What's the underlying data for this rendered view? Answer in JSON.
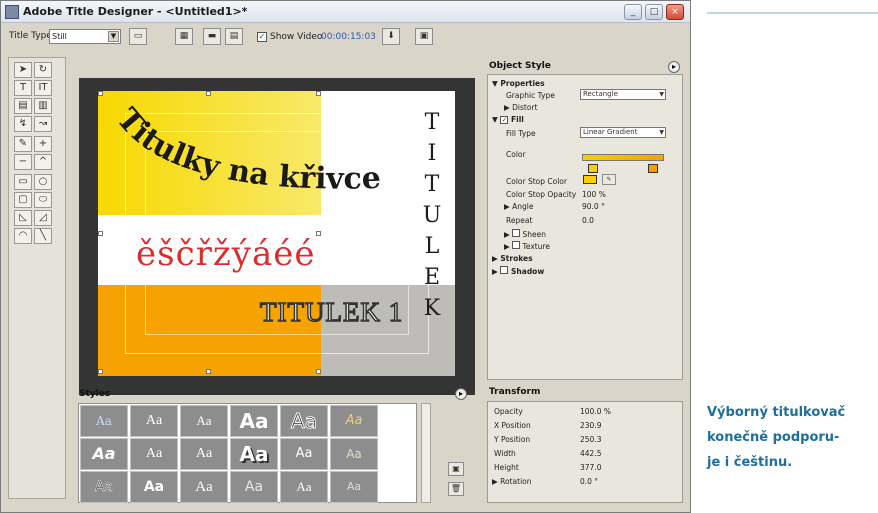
{
  "window": {
    "title": "Adobe Title Designer - <Untitled1>*",
    "min_label": "_",
    "max_label": "□",
    "close_label": "×"
  },
  "toolbar": {
    "title_type_label": "Title Type:",
    "title_type_value": "Still",
    "show_video_label": "Show Video",
    "timecode": "00:00:15:03",
    "show_video_checked": true
  },
  "canvas": {
    "curved_text": "Titulky na křivce",
    "red_text": "ěščřžýáéé",
    "outline_text": "TITULEK 1",
    "vertical_letters": [
      "T",
      "I",
      "T",
      "U",
      "L",
      "E",
      "K"
    ]
  },
  "object_style": {
    "header": "Object Style",
    "properties_label": "Properties",
    "graphic_type_label": "Graphic Type",
    "graphic_type_value": "Rectangle",
    "distort_label": "Distort",
    "fill_label": "Fill",
    "fill_type_label": "Fill Type",
    "fill_type_value": "Linear Gradient",
    "color_label": "Color",
    "color_stop_color_label": "Color Stop Color",
    "color_stop_opacity_label": "Color Stop Opacity",
    "color_stop_opacity_value": "100 %",
    "angle_label": "Angle",
    "angle_value": "90.0 °",
    "repeat_label": "Repeat",
    "repeat_value": "0.0",
    "sheen_label": "Sheen",
    "texture_label": "Texture",
    "strokes_label": "Strokes",
    "shadow_label": "Shadow",
    "gradient_start": "#f8d000",
    "gradient_end": "#f6a000"
  },
  "styles": {
    "header": "Styles",
    "samples": [
      "Aa",
      "Aa",
      "Aa",
      "Aa",
      "Aa",
      "Aa",
      "Aa",
      "Aa",
      "Aa",
      "Aa",
      "Aa",
      "Aa",
      "Aa",
      "Aa",
      "Aa",
      "Aa",
      "Aa",
      "Aa"
    ]
  },
  "transform": {
    "header": "Transform",
    "rows": [
      {
        "label": "Opacity",
        "value": "100.0 %"
      },
      {
        "label": "X Position",
        "value": "230.9"
      },
      {
        "label": "Y Position",
        "value": "250.3"
      },
      {
        "label": "Width",
        "value": "442.5"
      },
      {
        "label": "Height",
        "value": "377.0"
      },
      {
        "label": "Rotation",
        "value": "0.0 °"
      }
    ]
  },
  "caption": {
    "line1": "Výborný titulkovač",
    "line2": "konečně podporu-",
    "line3": "je i češtinu."
  },
  "colors": {
    "accent_caption": "#1d6f9e",
    "yellow": "#f7d800",
    "orange": "#f6a200",
    "red_text": "#d92e2e"
  }
}
